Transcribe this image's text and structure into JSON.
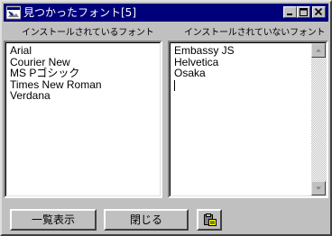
{
  "window": {
    "title": "見つかったフォント[5]"
  },
  "title_buttons": {
    "minimize": "minimize",
    "maximize": "maximize",
    "close": "close"
  },
  "installed": {
    "label": "インストールされているフォント",
    "items": [
      "Arial",
      "Courier New",
      "MS Pゴシック",
      "Times New Roman",
      "Verdana"
    ]
  },
  "not_installed": {
    "label": "インストールされていないフォント",
    "items": [
      "Embassy JS",
      "Helvetica",
      "Osaka"
    ]
  },
  "buttons": {
    "list": "一覧表示",
    "close": "閉じる"
  },
  "icons": {
    "app": "app-window-icon",
    "paste": "clipboard-paste-icon"
  }
}
